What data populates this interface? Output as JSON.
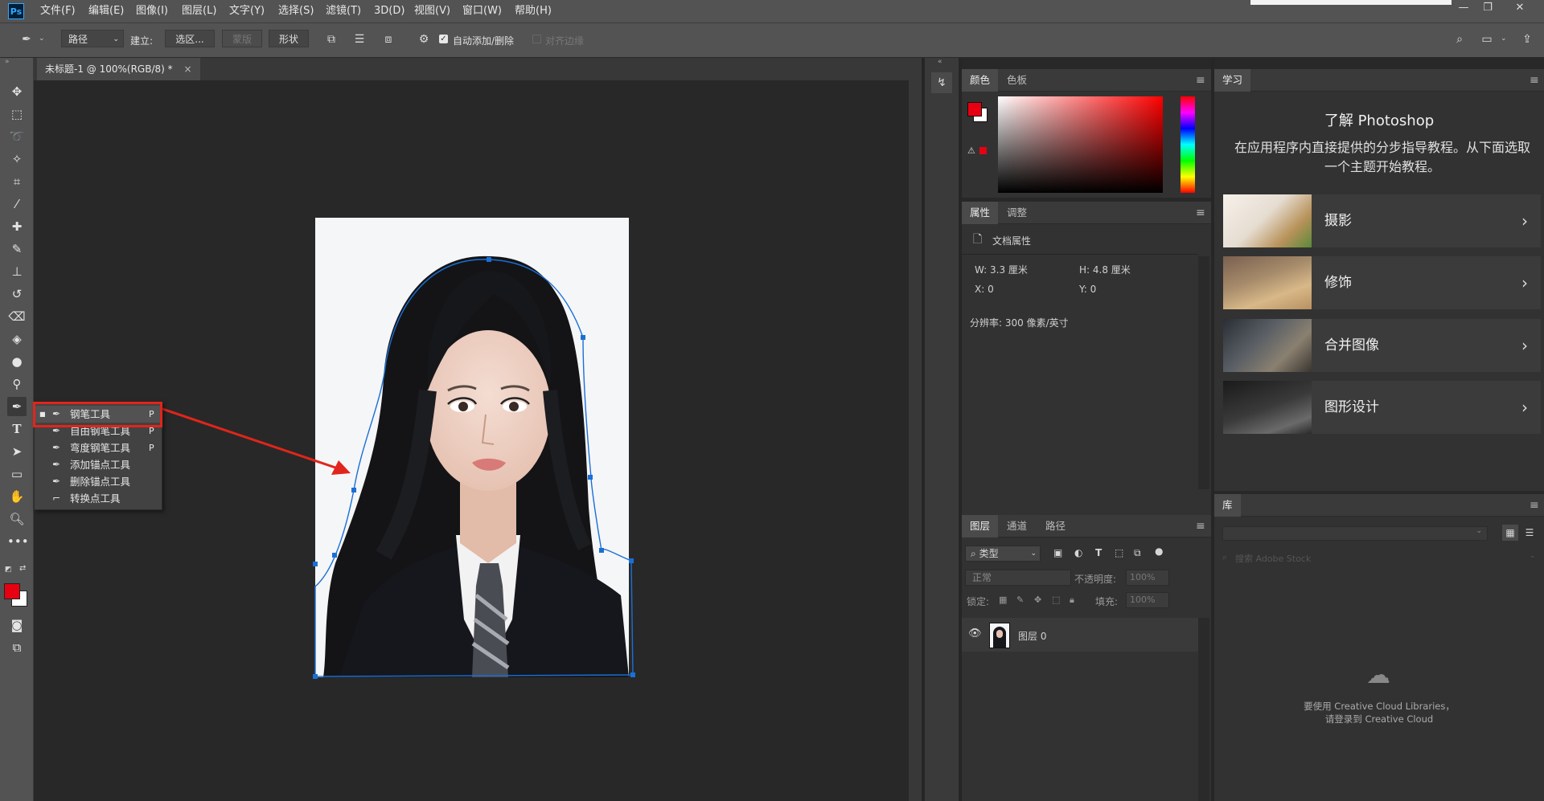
{
  "app": {
    "logo": "Ps"
  },
  "menu": [
    "文件(F)",
    "编辑(E)",
    "图像(I)",
    "图层(L)",
    "文字(Y)",
    "选择(S)",
    "滤镜(T)",
    "3D(D)",
    "视图(V)",
    "窗口(W)",
    "帮助(H)"
  ],
  "window_controls": [
    "—",
    "❐",
    "✕"
  ],
  "options": {
    "mode_value": "路径",
    "build_label": "建立:",
    "selection_btn": "选区...",
    "mask_btn": "蒙版",
    "shape_btn": "形状",
    "auto_add_delete": "自动添加/删除",
    "align_edges": "对齐边缘"
  },
  "document": {
    "tab_title": "未标题-1 @ 100%(RGB/8) *",
    "close": "×"
  },
  "tool_flyout": {
    "items": [
      {
        "label": "钢笔工具",
        "key": "P",
        "icon": "pen-icon"
      },
      {
        "label": "自由钢笔工具",
        "key": "P",
        "icon": "freeform-pen-icon"
      },
      {
        "label": "弯度钢笔工具",
        "key": "P",
        "icon": "curvature-pen-icon"
      },
      {
        "label": "添加锚点工具",
        "key": "",
        "icon": "add-anchor-icon"
      },
      {
        "label": "删除锚点工具",
        "key": "",
        "icon": "delete-anchor-icon"
      },
      {
        "label": "转换点工具",
        "key": "",
        "icon": "convert-point-icon"
      }
    ]
  },
  "color_panel": {
    "tabs": [
      "颜色",
      "色板"
    ],
    "foreground": "#e60012",
    "background": "#ffffff"
  },
  "properties_panel": {
    "tabs": [
      "属性",
      "调整"
    ],
    "section": "文档属性",
    "w": "W:  3.3 厘米",
    "h": "H:  4.8 厘米",
    "x": "X:  0",
    "y": "Y:  0",
    "resolution": "分辨率: 300 像素/英寸"
  },
  "layers_panel": {
    "tabs": [
      "图层",
      "通道",
      "路径"
    ],
    "filter": "类型",
    "blend_mode": "正常",
    "opacity_label": "不透明度:",
    "opacity_value": "100%",
    "lock_label": "锁定:",
    "fill_label": "填充:",
    "fill_value": "100%",
    "layer_name": "图层 0"
  },
  "learn_panel": {
    "tab": "学习",
    "title": "了解 Photoshop",
    "description": "在应用程序内直接提供的分步指导教程。从下面选取一个主题开始教程。",
    "cards": [
      "摄影",
      "修饰",
      "合并图像",
      "图形设计"
    ]
  },
  "library_panel": {
    "tab": "库",
    "search_placeholder": "搜索 Adobe Stock",
    "message_line1": "要使用 Creative Cloud Libraries，",
    "message_line2": "请登录到 Creative Cloud"
  },
  "colors": {
    "accent_red": "#e1251b",
    "path_blue": "#1a6fd6"
  }
}
